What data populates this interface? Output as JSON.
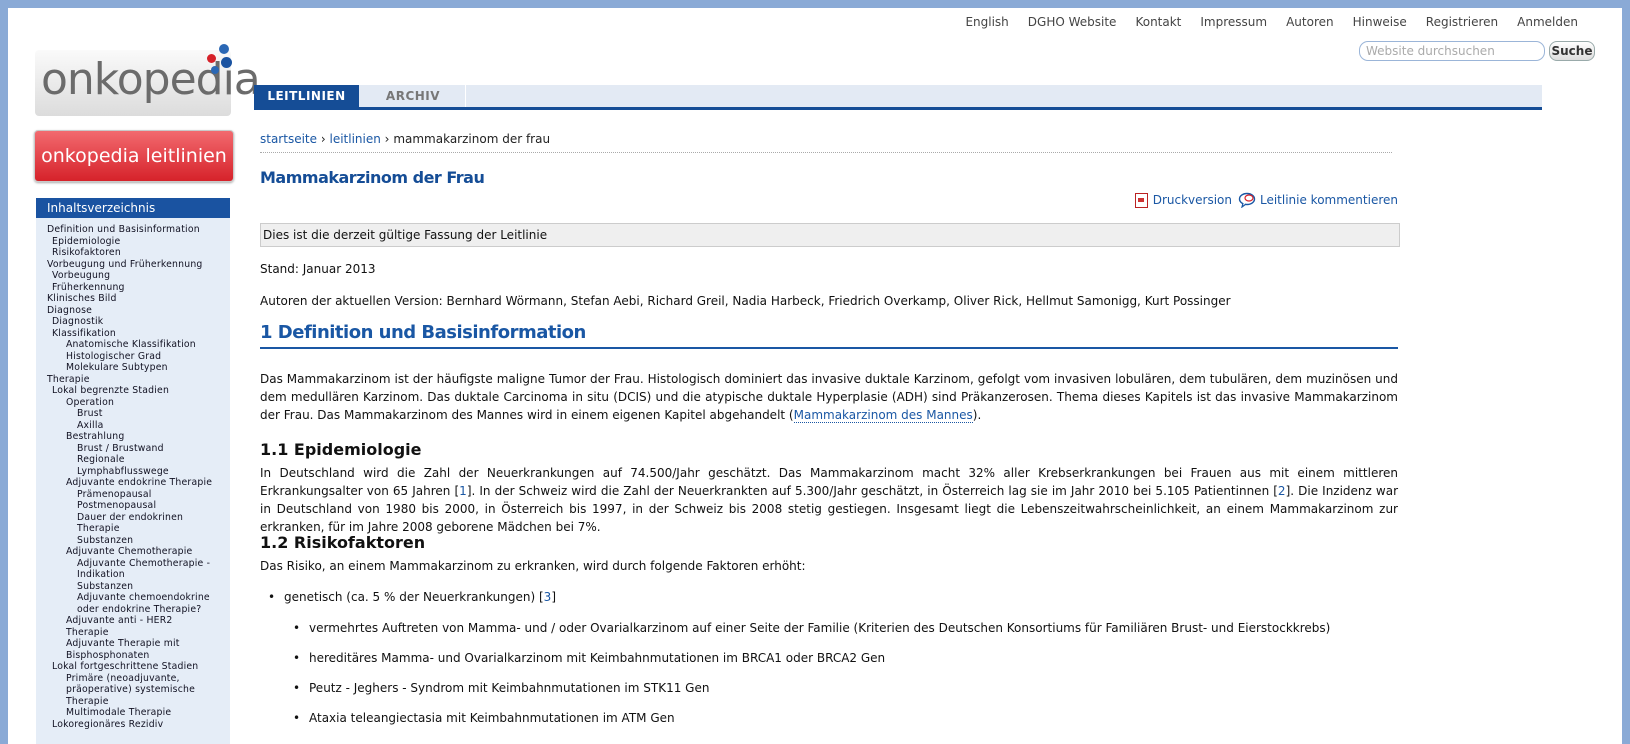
{
  "topnav": [
    "English",
    "DGHO Website",
    "Kontakt",
    "Impressum",
    "Autoren",
    "Hinweise",
    "Registrieren",
    "Anmelden"
  ],
  "search": {
    "placeholder": "Website durchsuchen",
    "button": "Suche"
  },
  "logo": {
    "text": "onkopedia"
  },
  "banner": {
    "text": "onkopedia leitlinien"
  },
  "tabs": {
    "active": "LEITLINIEN",
    "other": "ARCHIV"
  },
  "sidebar": {
    "title": "Inhaltsverzeichnis",
    "items": [
      {
        "label": "Definition und Basisinformation",
        "level": 0
      },
      {
        "label": "Epidemiologie",
        "level": 1
      },
      {
        "label": "Risikofaktoren",
        "level": 1
      },
      {
        "label": "Vorbeugung und Früherkennung",
        "level": 0
      },
      {
        "label": "Vorbeugung",
        "level": 1
      },
      {
        "label": "Früherkennung",
        "level": 1
      },
      {
        "label": "Klinisches Bild",
        "level": 0
      },
      {
        "label": "Diagnose",
        "level": 0
      },
      {
        "label": "Diagnostik",
        "level": 1
      },
      {
        "label": "Klassifikation",
        "level": 1
      },
      {
        "label": "Anatomische Klassifikation",
        "level": 2
      },
      {
        "label": "Histologischer Grad",
        "level": 2
      },
      {
        "label": "Molekulare Subtypen",
        "level": 2
      },
      {
        "label": "Therapie",
        "level": 0
      },
      {
        "label": "Lokal begrenzte Stadien",
        "level": 1
      },
      {
        "label": "Operation",
        "level": 2
      },
      {
        "label": "Brust",
        "level": 3
      },
      {
        "label": "Axilla",
        "level": 3
      },
      {
        "label": "Bestrahlung",
        "level": 2
      },
      {
        "label": "Brust / Brustwand",
        "level": 3
      },
      {
        "label": "Regionale",
        "level": 3
      },
      {
        "label": "Lymphabflusswege",
        "level": 3
      },
      {
        "label": "Adjuvante endokrine Therapie",
        "level": 2
      },
      {
        "label": "Prämenopausal",
        "level": 3
      },
      {
        "label": "Postmenopausal",
        "level": 3
      },
      {
        "label": "Dauer der endokrinen",
        "level": 3
      },
      {
        "label": "Therapie",
        "level": 3
      },
      {
        "label": "Substanzen",
        "level": 3
      },
      {
        "label": "Adjuvante Chemotherapie",
        "level": 2
      },
      {
        "label": "Adjuvante Chemotherapie -",
        "level": 3
      },
      {
        "label": "Indikation",
        "level": 3
      },
      {
        "label": "Substanzen",
        "level": 3
      },
      {
        "label": "Adjuvante chemoendokrine",
        "level": 3
      },
      {
        "label": "oder endokrine Therapie?",
        "level": 3
      },
      {
        "label": "Adjuvante anti - HER2",
        "level": 2
      },
      {
        "label": "Therapie",
        "level": 2
      },
      {
        "label": "Adjuvante Therapie mit",
        "level": 2
      },
      {
        "label": "Bisphosphonaten",
        "level": 2
      },
      {
        "label": "Lokal fortgeschrittene Stadien",
        "level": 1
      },
      {
        "label": "Primäre (neoadjuvante,",
        "level": 2
      },
      {
        "label": "präoperative) systemische",
        "level": 2
      },
      {
        "label": "Therapie",
        "level": 2
      },
      {
        "label": "Multimodale Therapie",
        "level": 2
      },
      {
        "label": "Lokoregionäres Rezidiv",
        "level": 1
      }
    ]
  },
  "breadcrumb": {
    "home": "startseite",
    "section": "leitlinien",
    "current": "mammakarzinom der frau",
    "sep": "›"
  },
  "page_title": "Mammakarzinom der Frau",
  "actions": {
    "print": "Druckversion",
    "comment": "Leitlinie kommentieren"
  },
  "notice": "Dies ist die derzeit gültige Fassung der Leitlinie",
  "stand": "Stand: Januar 2013",
  "authors": "Autoren der aktuellen Version: Bernhard Wörmann, Stefan Aebi, Richard Greil, Nadia Harbeck, Friedrich Overkamp, Oliver Rick, Hellmut Samonigg, Kurt Possinger",
  "section1": {
    "heading": "1 Definition und Basisinformation",
    "para_a": "Das Mammakarzinom ist der häufigste maligne Tumor der Frau. Histologisch dominiert das invasive duktale Karzinom, gefolgt vom invasiven lobulären, dem tubulären, dem muzinösen und dem medullären Karzinom. Das duktale Carcinoma in situ (DCIS) und die atypische duktale Hyperplasie (ADH) sind Präkanzerosen. Thema dieses Kapitels ist das invasive Mammakarzinom der Frau. Das Mammakarzinom des Mannes wird in einem eigenen Kapitel abgehandelt (",
    "para_link": "Mammakarzinom des Mannes",
    "para_b": ")."
  },
  "section11": {
    "heading": "1.1 Epidemiologie",
    "t1": "In Deutschland wird die Zahl der Neuerkrankungen auf 74.500/Jahr geschätzt. Das Mammakarzinom macht 32% aller Krebserkrankungen bei Frauen aus mit einem mittleren Erkrankungsalter von 65 Jahren [",
    "r1": "1",
    "t2": "]. In der Schweiz wird die Zahl der Neuerkrankten auf 5.300/Jahr geschätzt, in Österreich lag sie im Jahr 2010 bei 5.105 Patientinnen [",
    "r2": "2",
    "t3": "]. Die Inzidenz war in Deutschland von 1980 bis 2000, in Österreich bis 1997, in der Schweiz bis 2008 stetig gestiegen. Insgesamt liegt die Lebenszeitwahrscheinlichkeit, an einem Mammakarzinom zur erkranken, für im Jahre 2008 geborene Mädchen bei 7%."
  },
  "section12": {
    "heading": "1.2 Risikofaktoren",
    "intro": "Das Risiko, an einem Mammakarzinom zu erkranken, wird durch folgende Faktoren erhöht:",
    "b1_text": "genetisch (ca. 5 % der Neuerkrankungen) [",
    "b1_ref": "3",
    "b1_end": "]",
    "sub": [
      "vermehrtes Auftreten von Mamma- und / oder Ovarialkarzinom auf einer Seite der Familie (Kriterien des Deutschen Konsortiums für Familiären Brust- und Eierstockkrebs)",
      "hereditäres Mamma- und Ovarialkarzinom mit Keimbahnmutationen im BRCA1 oder BRCA2 Gen",
      "Peutz - Jeghers - Syndrom mit Keimbahnmutationen im STK11 Gen",
      "Ataxia teleangiectasia mit Keimbahnmutationen im ATM Gen"
    ]
  },
  "colors": {
    "brand_blue": "#154d96",
    "link_blue": "#1a57a4",
    "banner_red": "#d6222a",
    "sidebar_bg": "#e5edf7"
  }
}
